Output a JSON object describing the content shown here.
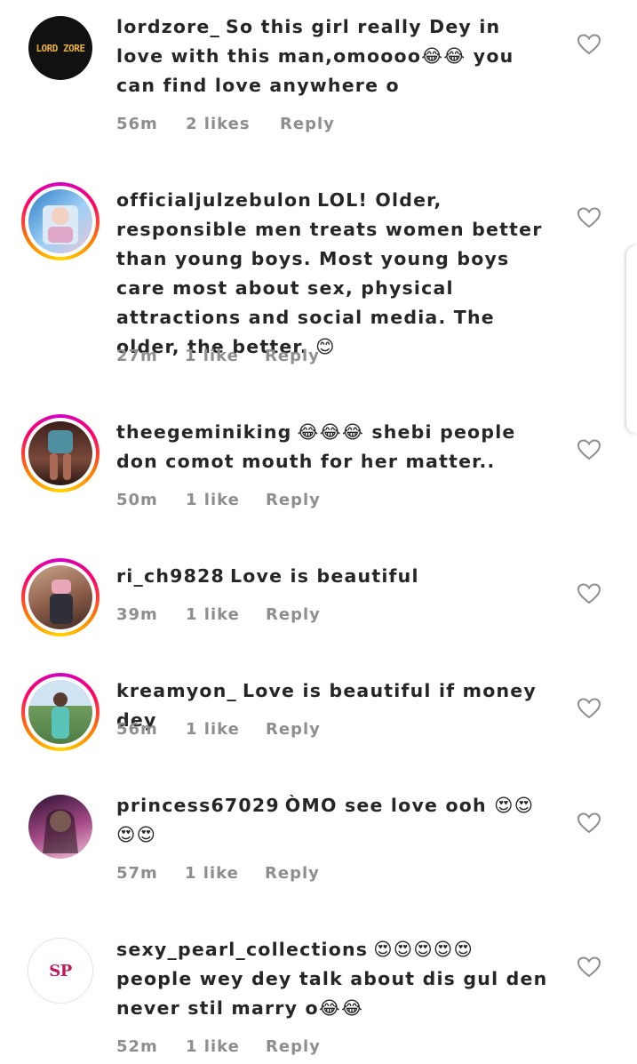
{
  "comments": [
    {
      "username": "lordzore_",
      "text": "So this girl really Dey in love with this man,omoooo😂😂 you can find love anywhere o",
      "time": "56m",
      "likes": "2 likes",
      "reply": "Reply",
      "avatar_text": "LORD ZORE",
      "avatar_bg": "#111111",
      "avatar_fg": "#e6b13a",
      "has_story_ring": false
    },
    {
      "username": "officialjulzebulon",
      "text": "LOL! Older, responsible men treats women better than young boys. Most young boys care most about sex, physical attractions and social media. The older, the better. 😊",
      "time": "27m",
      "likes": "1 like",
      "reply": "Reply",
      "avatar_text": "",
      "avatar_bg": "#3a8fd6",
      "has_story_ring": true
    },
    {
      "username": "theegeminiking",
      "text": "😂😂😂 shebi people don comot mouth for her matter..",
      "time": "50m",
      "likes": "1 like",
      "reply": "Reply",
      "avatar_text": "",
      "avatar_bg": "#5a3228",
      "has_story_ring": true
    },
    {
      "username": "ri_ch9828",
      "text": "Love is beautiful",
      "time": "39m",
      "likes": "1 like",
      "reply": "Reply",
      "avatar_text": "",
      "avatar_bg": "#9c6b4f",
      "has_story_ring": true
    },
    {
      "username": "kreamyon_",
      "text": "Love is beautiful if money dey",
      "time": "56m",
      "likes": "1 like",
      "reply": "Reply",
      "avatar_text": "",
      "avatar_bg": "#6aa7a0",
      "has_story_ring": true
    },
    {
      "username": "princess67029",
      "text": "ÒMO see love ooh 😍😍😍😍",
      "time": "57m",
      "likes": "1 like",
      "reply": "Reply",
      "avatar_text": "",
      "avatar_bg": "#7a3b6e",
      "has_story_ring": false
    },
    {
      "username": "sexy_pearl_collections",
      "text": "😍😍😍😍😍 people wey dey talk about dis gul den never stil marry o😂😂",
      "time": "52m",
      "likes": "1 like",
      "reply": "Reply",
      "avatar_text": "SP",
      "avatar_bg": "#ffffff",
      "avatar_fg": "#c2185b",
      "has_story_ring": false
    }
  ],
  "colors": {
    "text": "#262626",
    "meta": "#8e8e8e",
    "heart_stroke": "#8e8e8e"
  },
  "icons": {
    "like": "heart-outline-icon"
  }
}
